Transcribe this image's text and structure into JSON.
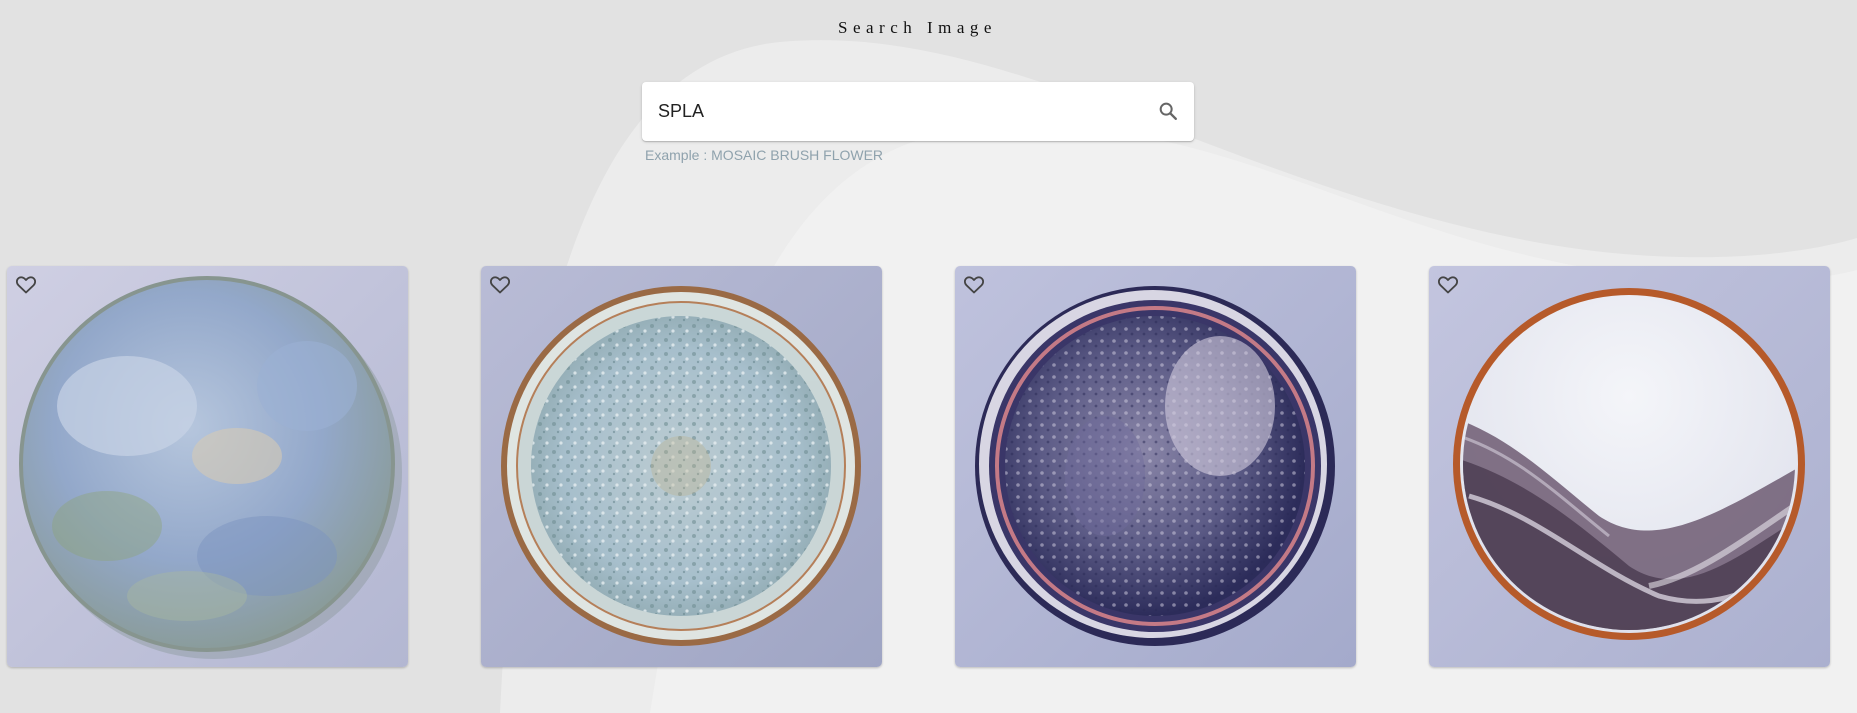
{
  "header": {
    "title": "Search Image"
  },
  "search": {
    "value": "SPLA",
    "placeholder": "",
    "helper": "Example : MOSAIC BRUSH FLOWER",
    "icon": "search-icon"
  },
  "results": [
    {
      "alt": "Blue and green watercolor-glazed ceramic plate",
      "icon": "heart-outline-icon"
    },
    {
      "alt": "Speckled pale blue ceramic plate with rust rim",
      "icon": "heart-outline-icon"
    },
    {
      "alt": "Purple and pink splash-glazed ceramic plate",
      "icon": "heart-outline-icon"
    },
    {
      "alt": "White plate with purple marbled splash and orange rim",
      "icon": "heart-outline-icon"
    }
  ],
  "colors": {
    "background": "#e2e2e2",
    "helper_text": "#8fa2ad",
    "card_background": "#b9bdd6"
  }
}
